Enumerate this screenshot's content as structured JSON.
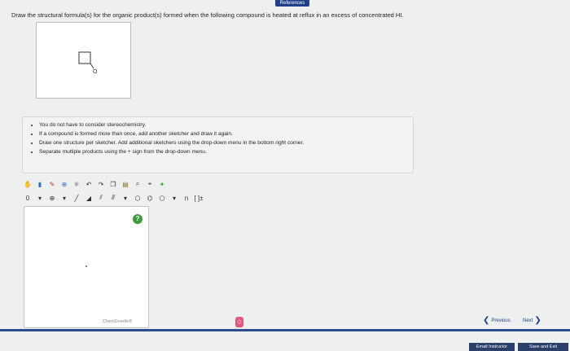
{
  "header": {
    "references_tab": "References"
  },
  "question": {
    "prompt": "Draw the structural formula(s) for the organic product(s) formed when the following compound is heated at reflux in an excess of concentrated HI."
  },
  "molecule": {
    "atom_label": "O"
  },
  "notes": {
    "items": [
      "You do not have to consider stereochemistry.",
      "If a compound is formed more than once, add another sketcher and draw it again.",
      "Draw one structure per sketcher. Add additional sketchers using the drop-down menu in the bottom right corner.",
      "Separate multiple products using the + sign from the drop-down menu."
    ]
  },
  "sketcher": {
    "brand": "ChemDoodle®",
    "help_symbol": "?",
    "toolbar_text": {
      "counter": "0",
      "charge": "[ ]±",
      "label": "n"
    }
  },
  "navigation": {
    "previous_label": "Previous",
    "next_label": "Next",
    "menu_symbol": "◇"
  },
  "footer": {
    "email_label": "Email Instructor",
    "save_label": "Save and Exit"
  },
  "colors": {
    "accent": "#1f3f8a",
    "help": "#3e9a3c",
    "menu": "#e0567e"
  }
}
